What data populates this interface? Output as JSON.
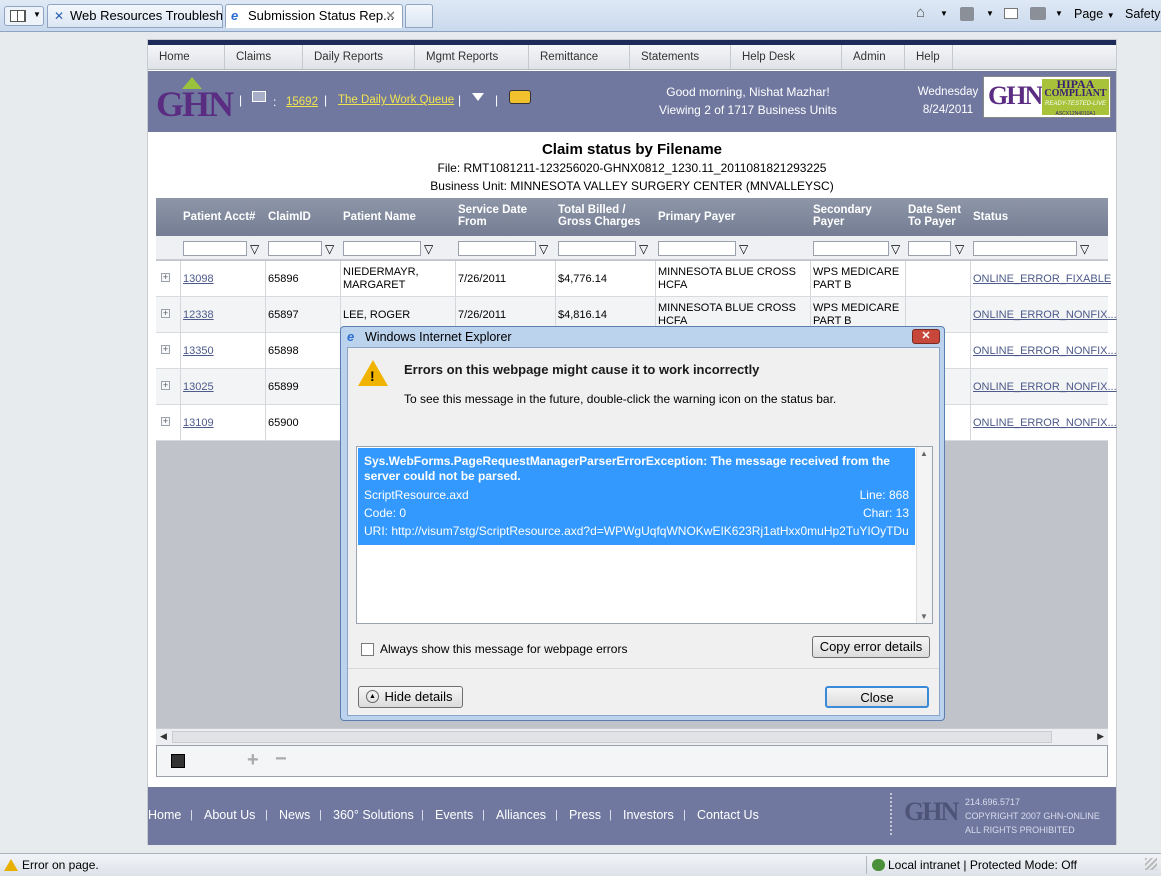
{
  "browser": {
    "tabs": [
      {
        "label": "Web Resources Troublesh..."
      },
      {
        "label": "Submission Status Rep..."
      }
    ],
    "commands": {
      "page": "Page",
      "safety": "Safety"
    }
  },
  "nav": {
    "items": [
      "Home",
      "Claims",
      "Daily Reports",
      "Mgmt Reports",
      "Remittance",
      "Statements",
      "Help Desk",
      "Admin",
      "Help"
    ]
  },
  "header": {
    "msg_count": "15692",
    "work_queue": "The Daily Work Queue",
    "greeting": "Good morning, Nishat Mazhar!",
    "units": "Viewing 2 of 1717 Business Units",
    "day": "Wednesday",
    "date": "8/24/2011",
    "logo_text": "GHN",
    "badge": {
      "line1": "HIPAA",
      "line2": "COMPLIANT",
      "line3": "READY-TESTED-LIVE",
      "line4": "ASCX12N4010A1"
    }
  },
  "report": {
    "title": "Claim status by Filename",
    "file": "File: RMT1081211-123256020-GHNX0812_1230.11_2011081821293225",
    "business_unit": "Business Unit: MINNESOTA VALLEY SURGERY CENTER (MNVALLEYSC)"
  },
  "grid": {
    "columns": [
      {
        "l1": "Patient Acct#",
        "l2": ""
      },
      {
        "l1": "ClaimID",
        "l2": ""
      },
      {
        "l1": "Patient Name",
        "l2": ""
      },
      {
        "l1": "Service Date",
        "l2": "From"
      },
      {
        "l1": "Total Billed /",
        "l2": "Gross Charges"
      },
      {
        "l1": "Primary Payer",
        "l2": ""
      },
      {
        "l1": "Secondary",
        "l2": "Payer"
      },
      {
        "l1": "Date Sent",
        "l2": "To Payer"
      },
      {
        "l1": "Status",
        "l2": ""
      }
    ],
    "rows": [
      {
        "acct": "13098",
        "claim": "65896",
        "name1": "NIEDERMAYR,",
        "name2": "MARGARET",
        "date": "7/26/2011",
        "billed": "$4,776.14",
        "primary1": "MINNESOTA BLUE CROSS",
        "primary2": "HCFA",
        "secondary1": "WPS MEDICARE",
        "secondary2": "PART B",
        "sent": "",
        "status": "ONLINE_ERROR_FIXABLE"
      },
      {
        "acct": "12338",
        "claim": "65897",
        "name1": "LEE, ROGER",
        "name2": "",
        "date": "7/26/2011",
        "billed": "$4,816.14",
        "primary1": "MINNESOTA BLUE CROSS",
        "primary2": "HCFA",
        "secondary1": "WPS MEDICARE",
        "secondary2": "PART B",
        "sent": "",
        "status": "ONLINE_ERROR_NONFIX..."
      },
      {
        "acct": "13350",
        "claim": "65898",
        "name1": "",
        "name2": "",
        "date": "",
        "billed": "",
        "primary1": "",
        "primary2": "",
        "secondary1": "",
        "secondary2": "",
        "sent": "",
        "status": "ONLINE_ERROR_NONFIX..."
      },
      {
        "acct": "13025",
        "claim": "65899",
        "name1": "",
        "name2": "",
        "date": "",
        "billed": "",
        "primary1": "",
        "primary2": "",
        "secondary1": "",
        "secondary2": "",
        "sent": "",
        "status": "ONLINE_ERROR_NONFIX..."
      },
      {
        "acct": "13109",
        "claim": "65900",
        "name1": "",
        "name2": "",
        "date": "",
        "billed": "",
        "primary1": "",
        "primary2": "",
        "secondary1": "",
        "secondary2": "",
        "sent": "",
        "status": "ONLINE_ERROR_NONFIX..."
      }
    ]
  },
  "footer": {
    "links": [
      "Home",
      "About Us",
      "News",
      "360° Solutions",
      "Events",
      "Alliances",
      "Press",
      "Investors",
      "Contact Us"
    ],
    "phone": "214.696.5717",
    "copyright": "COPYRIGHT 2007 GHN-ONLINE",
    "rights": "ALL RIGHTS PROHIBITED"
  },
  "dialog": {
    "title": "Windows Internet Explorer",
    "heading": "Errors on this webpage might cause it to work incorrectly",
    "sub": "To see this message in the future, double-click the warning icon on the status bar.",
    "error_msg": "Sys.WebForms.PageRequestManagerParserErrorException: The message received from the server could not be parsed.",
    "file": "ScriptResource.axd",
    "line": "Line: 868",
    "code": "Code: 0",
    "char": "Char: 13",
    "uri": "URI: http://visum7stg/ScriptResource.axd?d=WPWgUqfqWNOKwEIK623Rj1atHxx0muHp2TuYIOyTDu...",
    "checkbox_label": "Always show this message for webpage errors",
    "copy_button": "Copy error details",
    "hide_button": "Hide details",
    "close_button": "Close"
  },
  "status_bar": {
    "message": "Error on page.",
    "zone": "Local intranet | Protected Mode: Off"
  },
  "colors": {
    "header_bg": "#7078a0",
    "link_yellow": "#f2e44f",
    "selection_blue": "#3399ff"
  }
}
